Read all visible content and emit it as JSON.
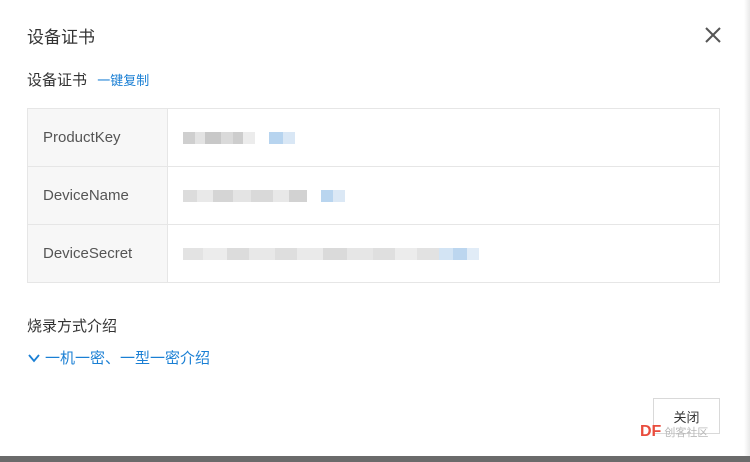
{
  "dialog": {
    "title": "设备证书",
    "close_icon": "close-icon"
  },
  "certificate": {
    "header": "设备证书",
    "copy_link": "一键复制",
    "rows": [
      {
        "key": "ProductKey",
        "value_state": "redacted"
      },
      {
        "key": "DeviceName",
        "value_state": "redacted"
      },
      {
        "key": "DeviceSecret",
        "value_state": "redacted"
      }
    ]
  },
  "burn": {
    "title": "烧录方式介绍",
    "toggle_label": "一机一密、一型一密介绍",
    "toggle_icon": "chevron-down-icon"
  },
  "footer": {
    "close_button": "关闭"
  },
  "watermark": {
    "brand": "DF",
    "sub": "创客社区"
  },
  "colors": {
    "link": "#1a7fd4",
    "table_border": "#e6e6e6",
    "key_bg": "#f7f7f7"
  }
}
